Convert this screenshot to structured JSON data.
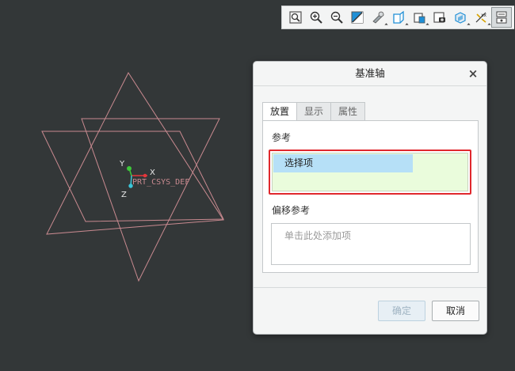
{
  "viewport": {
    "csys_label": "PRT_CSYS_DEF",
    "axis_x": "X",
    "axis_y": "Y",
    "axis_z": "Z",
    "colors": {
      "background": "#333738",
      "datum_plane": "#c98a90",
      "x_axis": "#e5363b",
      "y_axis": "#3ec83a",
      "z_axis": "#3bc6d9"
    }
  },
  "toolbar": {
    "buttons": [
      {
        "name": "refit-icon"
      },
      {
        "name": "zoom-in-icon"
      },
      {
        "name": "zoom-out-icon"
      },
      {
        "name": "repaint-icon"
      },
      {
        "name": "display-style-icon"
      },
      {
        "name": "saved-orientations-icon"
      },
      {
        "name": "view-manager-icon"
      },
      {
        "name": "perspective-view-icon"
      },
      {
        "name": "section-icon"
      },
      {
        "name": "datum-display-icon"
      },
      {
        "name": "annotation-display-icon"
      }
    ]
  },
  "dialog": {
    "title": "基准轴",
    "close": "×",
    "tabs": [
      "放置",
      "显示",
      "属性"
    ],
    "references_label": "参考",
    "reference_selected": "选择项",
    "offset_label": "偏移参考",
    "offset_placeholder": "单击此处添加项",
    "ok_label": "确定",
    "cancel_label": "取消"
  }
}
